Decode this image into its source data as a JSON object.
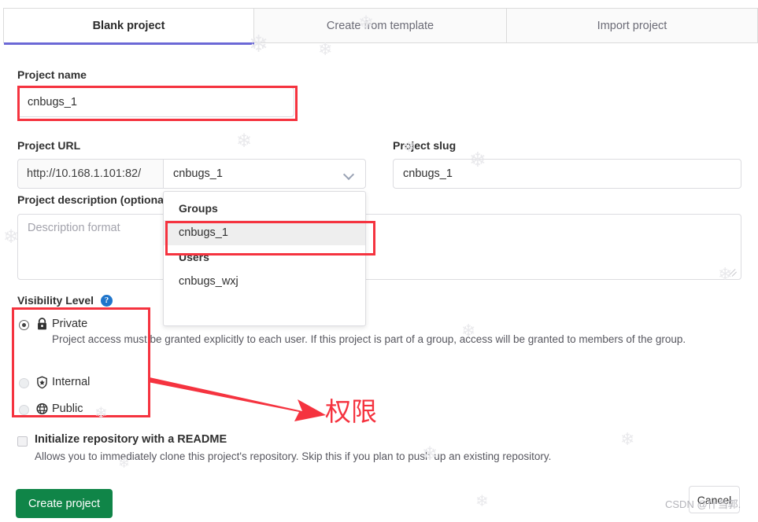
{
  "tabs": [
    {
      "label": "Blank project",
      "active": true
    },
    {
      "label": "Create from template",
      "active": false
    },
    {
      "label": "Import project",
      "active": false
    }
  ],
  "form": {
    "project_name_label": "Project name",
    "project_name_value": "cnbugs_1",
    "project_url_label": "Project URL",
    "project_url_prefix": "http://10.168.1.101:82/",
    "project_url_namespace": "cnbugs_1",
    "project_slug_label": "Project slug",
    "project_slug_value": "cnbugs_1",
    "description_label": "Project description (optional)",
    "description_placeholder": "Description format"
  },
  "dropdown": {
    "groups_header": "Groups",
    "group_item": "cnbugs_1",
    "users_header": "Users",
    "user_item": "cnbugs_wxj"
  },
  "visibility": {
    "label": "Visibility Level",
    "help_glyph": "?",
    "options": [
      {
        "title": "Private",
        "icon": "lock-icon",
        "selected": true,
        "description": "Project access must be granted explicitly to each user. If this project is part of a group, access will be granted to members of the group."
      },
      {
        "title": "Internal",
        "icon": "shield-icon",
        "selected": false,
        "description": ""
      },
      {
        "title": "Public",
        "icon": "globe-icon",
        "selected": false,
        "description": ""
      }
    ]
  },
  "readme": {
    "title": "Initialize repository with a README",
    "description": "Allows you to immediately clone this project's repository. Skip this if you plan to push up an existing repository.",
    "checked": false
  },
  "actions": {
    "create_label": "Create project",
    "cancel_label": "Cancel"
  },
  "annotation": {
    "text": "权限"
  },
  "watermark": {
    "text": "CSDN @什刍郭."
  },
  "colors": {
    "accent": "#6b68d6",
    "primary_button": "#108548",
    "annotation": "#f5333f",
    "help_icon": "#1f75cb"
  },
  "decor": {
    "snowflake": "❄"
  }
}
